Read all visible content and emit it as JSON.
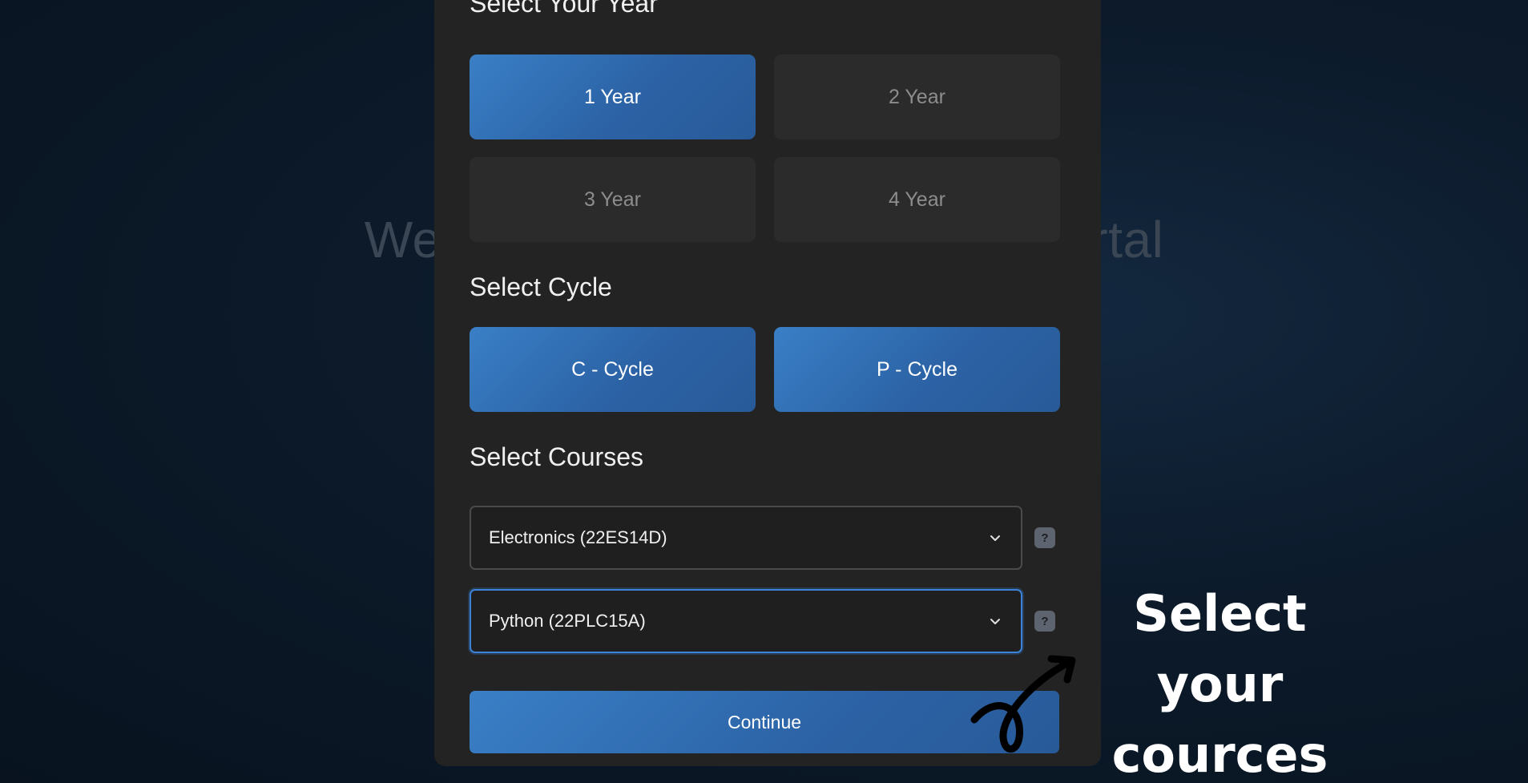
{
  "background": {
    "title_left": "Wel",
    "title_right": "ortal"
  },
  "year_section": {
    "heading": "Select Your Year",
    "options": [
      {
        "label": "1 Year",
        "selected": true
      },
      {
        "label": "2 Year",
        "selected": false
      },
      {
        "label": "3 Year",
        "selected": false
      },
      {
        "label": "4 Year",
        "selected": false
      }
    ]
  },
  "cycle_section": {
    "heading": "Select Cycle",
    "options": [
      {
        "label": "C - Cycle",
        "selected": true
      },
      {
        "label": "P - Cycle",
        "selected": true
      }
    ]
  },
  "courses_section": {
    "heading": "Select Courses",
    "selects": [
      {
        "value": "Electronics (22ES14D)",
        "help": "?"
      },
      {
        "value": "Python (22PLC15A)",
        "help": "?"
      }
    ]
  },
  "continue_label": "Continue",
  "annotation": {
    "line1": "Select your",
    "line2": "cources"
  },
  "colors": {
    "accent": "#2f6db3",
    "modal_bg": "#232323",
    "page_bg": "#0c1a2a"
  },
  "icons": {
    "select_chevron": "chevron-down-icon",
    "help": "question-icon",
    "annotation_arrow": "curly-arrow-icon"
  }
}
